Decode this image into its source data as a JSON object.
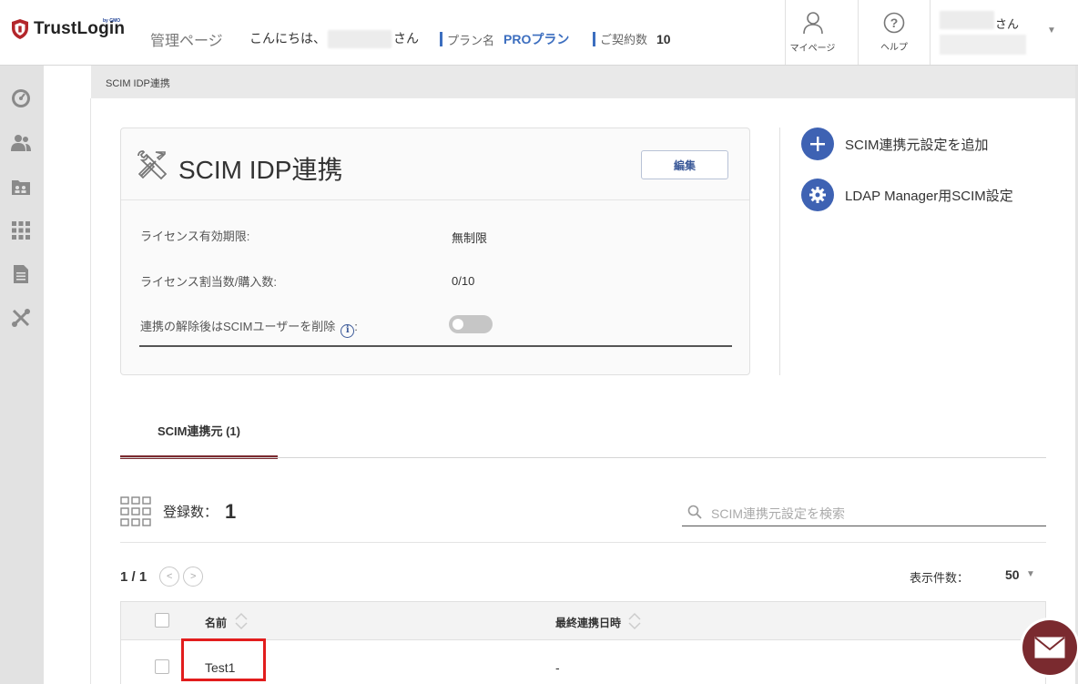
{
  "header": {
    "brand": "TrustLogin",
    "brand_sub": "by GMO",
    "admin_label": "管理ページ",
    "greeting_prefix": "こんにちは、",
    "greeting_suffix": "さん",
    "plan_label": "プラン名",
    "plan_value": "PROプラン",
    "contracts_label": "ご契約数",
    "contracts_value": "10",
    "mypage_label": "マイページ",
    "help_label": "ヘルプ",
    "user_suffix": "さん"
  },
  "sidebar": {
    "icons": [
      "dashboard-icon",
      "users-icon",
      "groups-icon",
      "apps-grid-icon",
      "document-icon",
      "tools-icon"
    ]
  },
  "breadcrumb": "SCIM IDP連携",
  "card": {
    "title": "SCIM IDP連携",
    "edit_label": "編集",
    "rows": [
      {
        "label": "ライセンス有効期限:",
        "value": "無制限"
      },
      {
        "label": "ライセンス割当数/購入数:",
        "value": "0/10"
      },
      {
        "label": "連携の解除後はSCIMユーザーを削除",
        "suffix": ":",
        "toggle": false
      }
    ]
  },
  "actions": [
    {
      "label": "SCIM連携元設定を追加",
      "icon": "plus-icon"
    },
    {
      "label": "LDAP Manager用SCIM設定",
      "icon": "gear-icon"
    }
  ],
  "tabs": [
    {
      "label": "SCIM連携元 (1)",
      "active": true
    }
  ],
  "count": {
    "label": "登録数：",
    "value": "1"
  },
  "search": {
    "placeholder": "SCIM連携元設定を検索"
  },
  "pager": {
    "text": "1 / 1"
  },
  "per_page": {
    "label": "表示件数：",
    "value": "50"
  },
  "table": {
    "columns": [
      "名前",
      "最終連携日時"
    ],
    "rows": [
      {
        "name": "Test1",
        "last_sync": "-"
      }
    ]
  },
  "colors": {
    "accent": "#3e62b3",
    "brand": "#7a2a2f",
    "highlight": "#e21d1d"
  }
}
